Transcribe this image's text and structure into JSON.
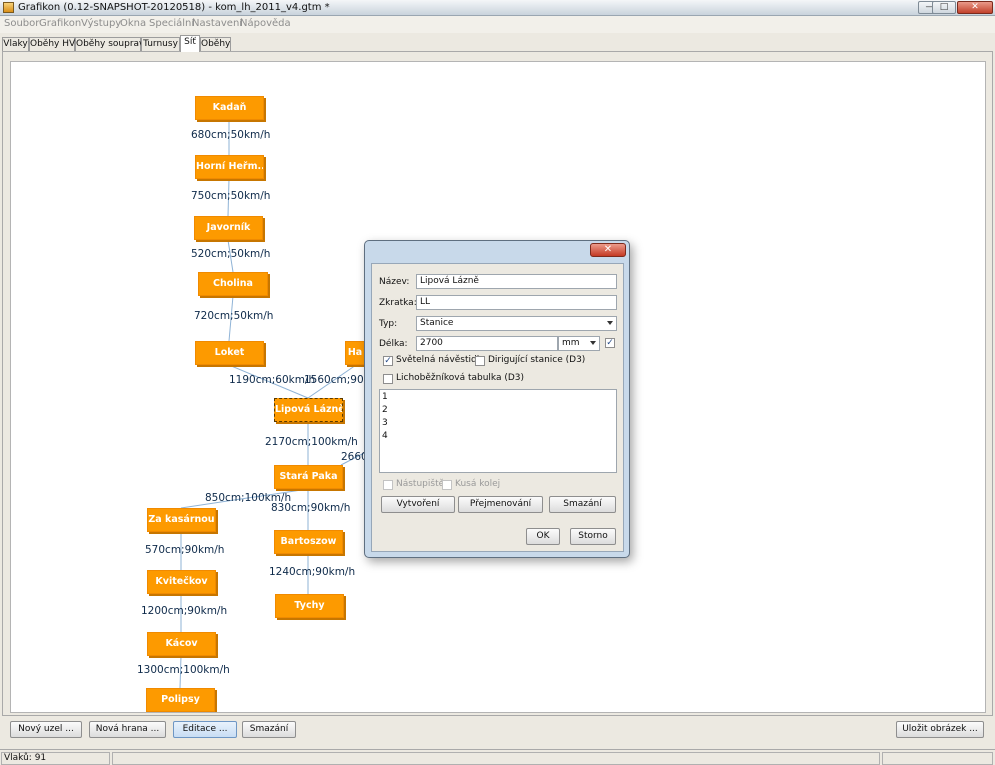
{
  "window": {
    "title": "Grafikon (0.12-SNAPSHOT-20120518) - kom_lh_2011_v4.gtm *",
    "minimize": "—",
    "maximize": "□",
    "close": "✕"
  },
  "menu": [
    "Soubor",
    "Grafikon",
    "Výstupy",
    "Okna",
    "Speciální",
    "Nastavení",
    "Nápověda"
  ],
  "tabs": [
    {
      "label": "Vlaky"
    },
    {
      "label": "Oběhy HV"
    },
    {
      "label": "Oběhy souprav"
    },
    {
      "label": "Turnusy"
    },
    {
      "label": "Síť",
      "active": true
    },
    {
      "label": "Oběhy"
    }
  ],
  "network": {
    "nodes": [
      "Kadaň",
      "Horní Heřm...",
      "Javorník",
      "Cholina",
      "Loket",
      "Ha",
      "Lipová Lázně",
      "Stará Paka",
      "Za kasárnou",
      "Bartoszow",
      "Kvitečkov",
      "Tychy",
      "Kácov",
      "Polipsy"
    ],
    "edge_labels": [
      "680cm;50km/h",
      "750cm;50km/h",
      "520cm;50km/h",
      "720cm;50km/h",
      "1190cm;60km/h",
      "1560cm;90km",
      "2170cm;100km/h",
      "2660",
      "850cm;100km/h",
      "830cm;90km/h",
      "570cm;90km/h",
      "1240cm;90km/h",
      "1200cm;90km/h",
      "1300cm;100km/h"
    ]
  },
  "buttons": {
    "new_node": "Nový uzel ...",
    "new_edge": "Nová hrana ...",
    "edit": "Editace ...",
    "delete": "Smazání",
    "save_image": "Uložit obrázek ..."
  },
  "status": {
    "trains": "Vlaků: 91"
  },
  "dialog": {
    "close": "✕",
    "name_label": "Název:",
    "name_value": "Lipová Lázně",
    "abbr_label": "Zkratka:",
    "abbr_value": "LL",
    "type_label": "Typ:",
    "type_value": "Stanice",
    "length_label": "Délka:",
    "length_value": "2700",
    "length_unit": "mm",
    "check_mark": "✓",
    "signals_label": "Světelná návěstidla",
    "signals_checked": true,
    "dispatch_label": "Dirigující stanice (D3)",
    "dispatch_checked": false,
    "odd_even_label": "Lichoběžníková tabulka (D3)",
    "odd_even_checked": false,
    "tracks": [
      "1",
      "2",
      "3",
      "4"
    ],
    "platform_label": "Nástupiště",
    "dead_end_label": "Kusá kolej",
    "create_btn": "Vytvoření",
    "rename_btn": "Přejmenování",
    "delete_btn": "Smazání",
    "ok_btn": "OK",
    "cancel_btn": "Storno"
  }
}
